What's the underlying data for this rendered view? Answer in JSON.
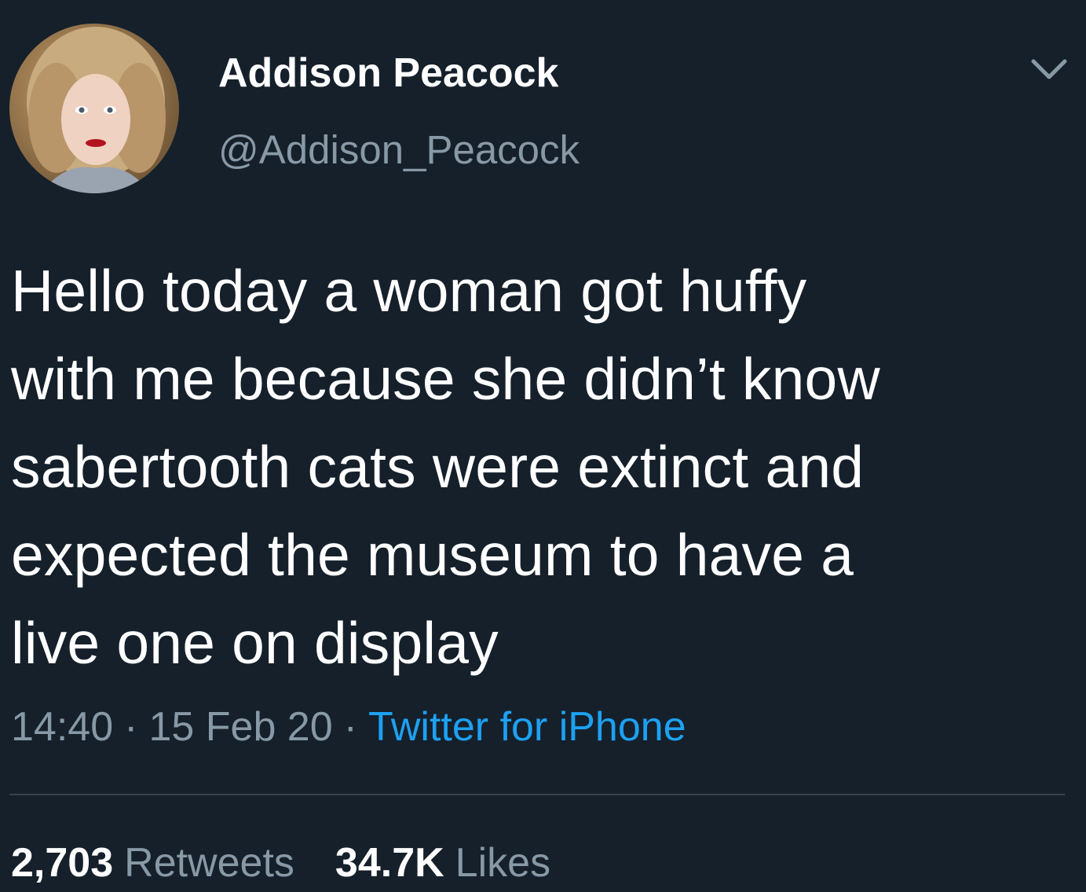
{
  "user": {
    "display_name": "Addison Peacock",
    "handle": "@Addison_Peacock",
    "avatar_icon": "profile-photo",
    "menu_icon": "chevron-down-icon"
  },
  "tweet": {
    "text_lines": [
      "Hello today a woman got huffy",
      "with me because she didn’t know",
      "sabertooth cats were extinct and",
      "expected the museum to have a",
      "live one on display"
    ]
  },
  "meta": {
    "time": "14:40",
    "separator": "·",
    "date": "15 Feb 20",
    "source": "Twitter for iPhone"
  },
  "stats": {
    "retweets_count": "2,703",
    "retweets_label": "Retweets",
    "likes_count": "34.7K",
    "likes_label": "Likes"
  },
  "colors": {
    "background": "#15202b",
    "primary_text": "#ffffff",
    "secondary_text": "#8899a6",
    "accent": "#1da1f2",
    "divider": "#38444d"
  }
}
